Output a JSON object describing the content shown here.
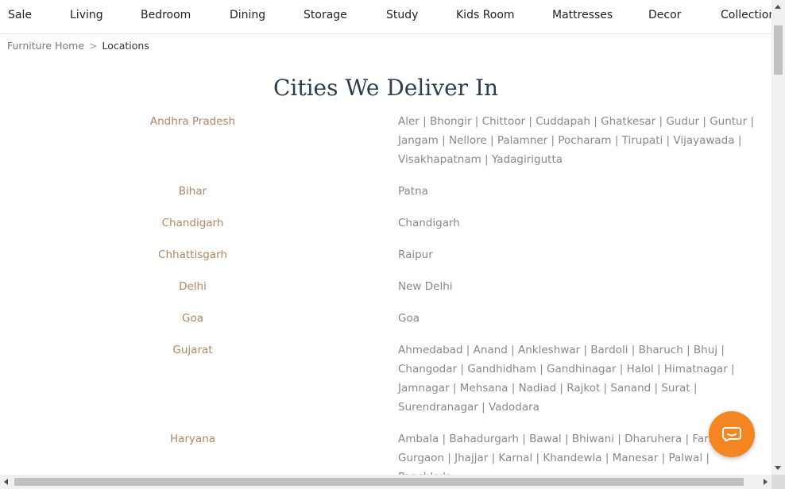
{
  "nav": {
    "items": [
      "Sale",
      "Living",
      "Bedroom",
      "Dining",
      "Storage",
      "Study",
      "Kids Room",
      "Mattresses",
      "Decor",
      "Collections"
    ]
  },
  "breadcrumb": {
    "home": "Furniture Home",
    "separator": ">",
    "current": "Locations"
  },
  "page": {
    "title": "Cities We Deliver In"
  },
  "states": [
    {
      "name": "Andhra Pradesh",
      "cities": [
        "Aler",
        "Bhongir",
        "Chittoor",
        "Cuddapah",
        "Ghatkesar",
        "Gudur",
        "Guntur",
        "Jangam",
        "Nellore",
        "Palamner",
        "Pocharam",
        "Tirupati",
        "Vijayawada",
        "Visakhapatnam",
        "Yadagirigutta"
      ]
    },
    {
      "name": "Bihar",
      "cities": [
        "Patna"
      ]
    },
    {
      "name": "Chandigarh",
      "cities": [
        "Chandigarh"
      ]
    },
    {
      "name": "Chhattisgarh",
      "cities": [
        "Raipur"
      ]
    },
    {
      "name": "Delhi",
      "cities": [
        "New Delhi"
      ]
    },
    {
      "name": "Goa",
      "cities": [
        "Goa"
      ]
    },
    {
      "name": "Gujarat",
      "cities": [
        "Ahmedabad",
        "Anand",
        "Ankleshwar",
        "Bardoli",
        "Bharuch",
        "Bhuj",
        "Changodar",
        "Gandhidham",
        "Gandhinagar",
        "Halol",
        "Himatnagar",
        "Jamnagar",
        "Mehsana",
        "Nadiad",
        "Rajkot",
        "Sanand",
        "Surat",
        "Surendranagar",
        "Vadodara"
      ]
    },
    {
      "name": "Haryana",
      "cities": [
        "Ambala",
        "Bahadurgarh",
        "Bawal",
        "Bhiwani",
        "Dharuhera",
        "Faridabad",
        "Gurgaon",
        "Jhajjar",
        "Karnal",
        "Khandewla",
        "Manesar",
        "Palwal",
        "Panchkula"
      ]
    }
  ],
  "colors": {
    "state": "#b08663",
    "city": "#888888",
    "title": "#2c3e50",
    "chat": "#f38620"
  },
  "icons": {
    "chat": "chat-bubble-icon"
  }
}
